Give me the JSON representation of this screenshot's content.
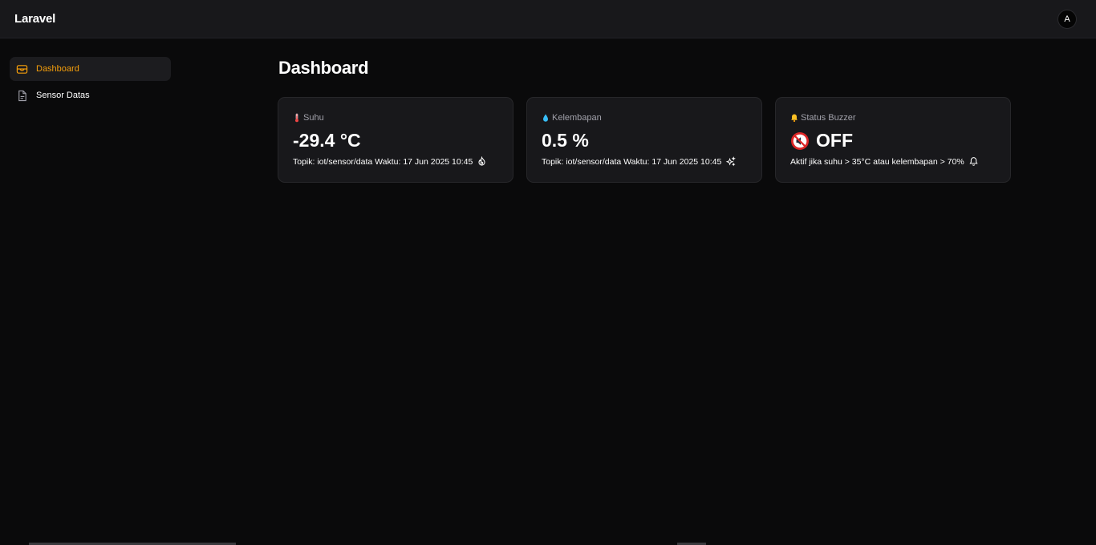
{
  "header": {
    "brand": "Laravel",
    "avatar_initial": "A"
  },
  "sidebar": {
    "items": [
      {
        "label": "Dashboard",
        "icon": "inbox-icon",
        "active": true
      },
      {
        "label": "Sensor Datas",
        "icon": "document-icon",
        "active": false
      }
    ]
  },
  "main": {
    "title": "Dashboard",
    "cards": [
      {
        "label": "Suhu",
        "label_icon": "thermometer-icon",
        "value": "-29.4 °C",
        "footer": "Topik: iot/sensor/data Waktu: 17 Jun 2025 10:45",
        "footer_icon": "fire-icon"
      },
      {
        "label": "Kelembapan",
        "label_icon": "droplet-icon",
        "value": "0.5 %",
        "footer": "Topik: iot/sensor/data Waktu: 17 Jun 2025 10:45",
        "footer_icon": "sparkles-icon"
      },
      {
        "label": "Status Buzzer",
        "label_icon": "bell-icon",
        "value": "OFF",
        "value_icon": "muted-speaker-icon",
        "footer": "Aktif jika suhu > 35°C atau kelembapan > 70%",
        "footer_icon": "bell-outline-icon"
      }
    ]
  },
  "colors": {
    "accent": "#f59e0b",
    "background": "#0a0a0b",
    "surface": "#18181b",
    "muted_text": "#a1a1aa",
    "alert_red": "#dc2626"
  }
}
